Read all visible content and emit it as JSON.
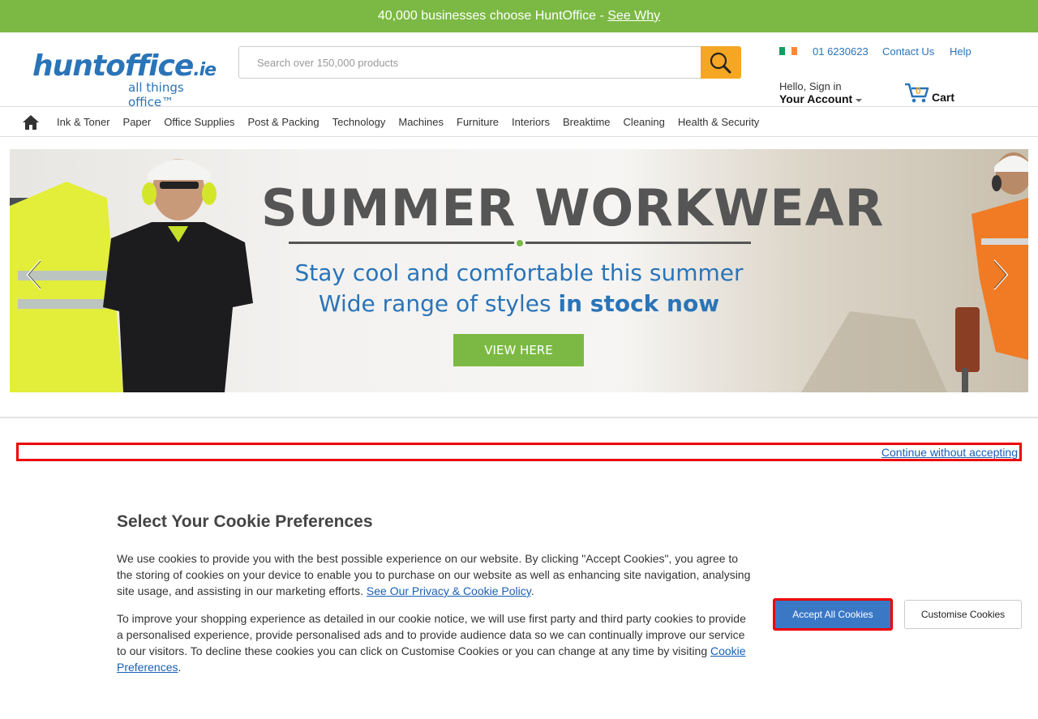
{
  "promo": {
    "text": "40,000 businesses choose HuntOffice - ",
    "link": "See Why"
  },
  "logo": {
    "main": "huntoffice",
    "tld": ".ie",
    "tagline": "all things office™"
  },
  "search": {
    "placeholder": "Search over 150,000 products"
  },
  "top_links": {
    "phone": "01 6230623",
    "contact": "Contact Us",
    "help": "Help"
  },
  "account": {
    "hello": "Hello, Sign in",
    "label": "Your Account"
  },
  "cart": {
    "count": "0",
    "label": "Cart"
  },
  "nav": [
    "Ink & Toner",
    "Paper",
    "Office Supplies",
    "Post & Packing",
    "Technology",
    "Machines",
    "Furniture",
    "Interiors",
    "Breaktime",
    "Cleaning",
    "Health & Security"
  ],
  "hero": {
    "title": "SUMMER WORKWEAR",
    "line1": "Stay cool and comfortable this summer",
    "line2_plain": "Wide range of styles ",
    "line2_bold": "in stock now",
    "cta": "VIEW HERE"
  },
  "cookie": {
    "continue": "Continue without accepting",
    "title": "Select Your Cookie Preferences",
    "p1": "We use cookies to provide you with the best possible experience on our website. By clicking \"Accept Cookies\", you agree to the storing of cookies on your device to enable you to purchase on our website as well as enhancing site navigation, analysing site usage, and assisting in our marketing efforts. ",
    "p1_link": "See Our Privacy & Cookie Policy",
    "p1_end": ".",
    "p2": "To improve your shopping experience as detailed in our cookie notice, we will use first party and third party cookies to provide a personalised experience, provide personalised ads and to provide audience data so we can continually improve our service to our visitors. To decline these cookies you can click on Customise Cookies or you can change at any time by visiting ",
    "p2_link": "Cookie Preferences",
    "p2_end": ".",
    "accept": "Accept All Cookies",
    "customise": "Customise Cookies"
  },
  "colors": {
    "brand_green": "#7cb944",
    "brand_blue": "#2a74b8",
    "search_orange": "#f5a623",
    "highlight_red": "#e00000"
  }
}
